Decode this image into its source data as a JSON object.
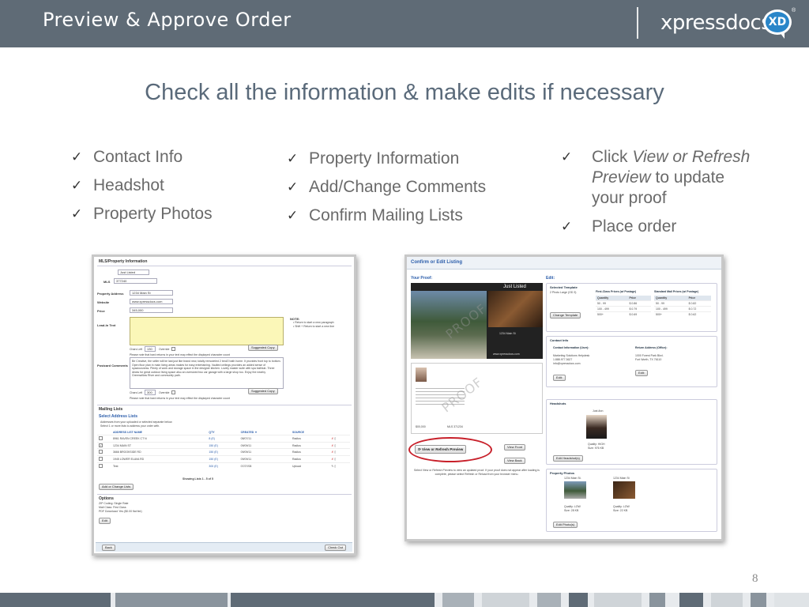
{
  "header": {
    "title": "Preview & Approve Order",
    "logo_text": "xpressdocs",
    "logo_badge": "XD",
    "logo_reg": "®"
  },
  "subtitle": "Check all the information & make edits if necessary",
  "checklists": {
    "col1": [
      "Contact Info",
      "Headshot",
      "Property Photos"
    ],
    "col2": [
      "Property Information",
      "Add/Change Comments",
      "Confirm Mailing Lists"
    ],
    "col3": {
      "item1_pre": "Click ",
      "item1_em": "View or Refresh Preview",
      "item1_post": " to update your proof",
      "item2": "Place order"
    }
  },
  "check_glyph": "✓",
  "left_shot": {
    "section_mls": "MLS/Property Information",
    "template_value": "Just Listed",
    "mls_label": "MLS",
    "mls_value": "377240",
    "address_label": "Property Address",
    "address_value": "1234 Main St",
    "website_label": "Website",
    "website_value": "www.xpressdocs.com",
    "price_label": "Price",
    "price_value": "345,000",
    "lead_label": "Lead-In Text",
    "note_label": "NOTE:",
    "note_line1": "• Return to start a new paragraph",
    "note_line2": "• Shift + Return to start a new line",
    "chars_left_label": "Chars Left",
    "chars_left_value": "130",
    "override_label": "Override",
    "suggested_copy": "Suggested Copy",
    "hint_text": "Please note that hard returns in your text may effect the displayed character count",
    "comments_label": "Postcard Comments",
    "comments_text": "Be Creative, the seller will be last just like brand new, totally remodeled 2 bed/2 bath home. It provides front top to bottom. Open floor plan in main living areas makes for easy entertaining. Vaulted ceilings provides an added sense of spaciousness. Plenty of work and storage space in the designer kitchen. Lovely master suite with spa bathtub. Three decks for great outdoor living space also an oversized two car garage with a large shop too. Enjoy the nearby Greenwillow River and community path.",
    "chars_left_value2": "300",
    "section_mailing": "Mailing Lists",
    "select_lists": "Select Address Lists",
    "select_hint1": "Addresses from your uploaded or selected separate below.",
    "select_hint2": "Select 1 or more lists to address your order with.",
    "table_headers": [
      "ADDRESS LIST NAME",
      "QTY",
      "CREATED ▼",
      "SOURCE"
    ],
    "table_rows": [
      [
        "8961 RAVEN CREEK CT N",
        "8 (E)",
        "08/07/11",
        "Radius"
      ],
      [
        "1234 MAIN ST",
        "150 (E)",
        "09/09/11",
        "Radius"
      ],
      [
        "3666 BROOKSIDE RD",
        "150 (E)",
        "09/09/11",
        "Radius"
      ],
      [
        "1945 LOWER ELAVA RD",
        "150 (E)",
        "09/09/11",
        "Radius"
      ],
      [
        "Test",
        "300 (E)",
        "07/27/08",
        "Upload"
      ]
    ],
    "showing": "Showing Lists 1 - 5 of 5",
    "add_change": "Add or Change Lists",
    "options_label": "Options",
    "opt1": "ZIP Coding: Single Rate",
    "opt2": "Mail Class: First Class",
    "opt3": "PDF Download: Yes ($0.00 flat fee)",
    "edit_btn": "Edit",
    "back_btn": "Back",
    "checkout_btn": "Check Out"
  },
  "right_shot": {
    "title": "Confirm or Edit Listing",
    "your_proof": "Your Proof:",
    "edit_label": "Edit:",
    "banner": "Just Listed",
    "proof_addr": "1234 Main St",
    "proof_web": "www.xpressdocs.com",
    "watermark": "PROOF",
    "proof_price": "$00,000",
    "proof_mls": "MLS 371234",
    "view_refresh": "View or Refresh Preview",
    "view_front": "View Front",
    "view_back": "View Back",
    "refresh_note": "Select View or Refresh Preview to view an updated proof. If your proof does not appear after loading is complete, please select Refresh or Reload from your browser menu.",
    "selected_template": "Selected Template",
    "template_name": "2 Photo Large (OD 3)",
    "change_template": "Change Template",
    "first_class_title": "First-Class Prices (w/ Postage)",
    "standard_title": "Standard Mail Prices (w/ Postage)",
    "price_headers": [
      "Quantity",
      "Price"
    ],
    "first_class_rows": [
      [
        "50 - 99",
        "$ 0.86"
      ],
      [
        "100 - 499",
        "$ 0.79"
      ],
      [
        "500+",
        "$ 0.69"
      ]
    ],
    "standard_rows": [
      [
        "50 - 99",
        "$ 0.82"
      ],
      [
        "100 - 499",
        "$ 0.72"
      ],
      [
        "500+",
        "$ 0.62"
      ]
    ],
    "contact_info": "Contact Info",
    "contact_user": "Contact Information (User):",
    "return_addr": "Return Address (Office):",
    "contact_lines": [
      "Marketing Solutions Helpdesk",
      "1.888.977.3627",
      "info@xpressdocs.com"
    ],
    "return_lines": [
      "1000 Forest Park Blvd.",
      "Fort Worth, TX 76110"
    ],
    "headshots": "Headshots",
    "agent_name": "Just Ann",
    "hs_quality": "Quality: HIGH",
    "hs_size": "Size: 976 KB",
    "edit_headshots": "Edit Headshot(s)",
    "property_photos": "Property Photos",
    "photo1_label": "1234 Main St.",
    "photo2_label": "1234 Main St",
    "photo1_quality": "Quality: LOW",
    "photo1_size": "Size: 28 KB",
    "photo2_quality": "Quality: LOW",
    "photo2_size": "Size: 22 KB",
    "edit_photos": "Edit Photo(s)"
  },
  "page_number": "8",
  "colors": {
    "header": "#5f6b76",
    "subtitle": "#5a6a7a",
    "accent_blue": "#2a5caa",
    "highlight_red": "#c8202a"
  }
}
